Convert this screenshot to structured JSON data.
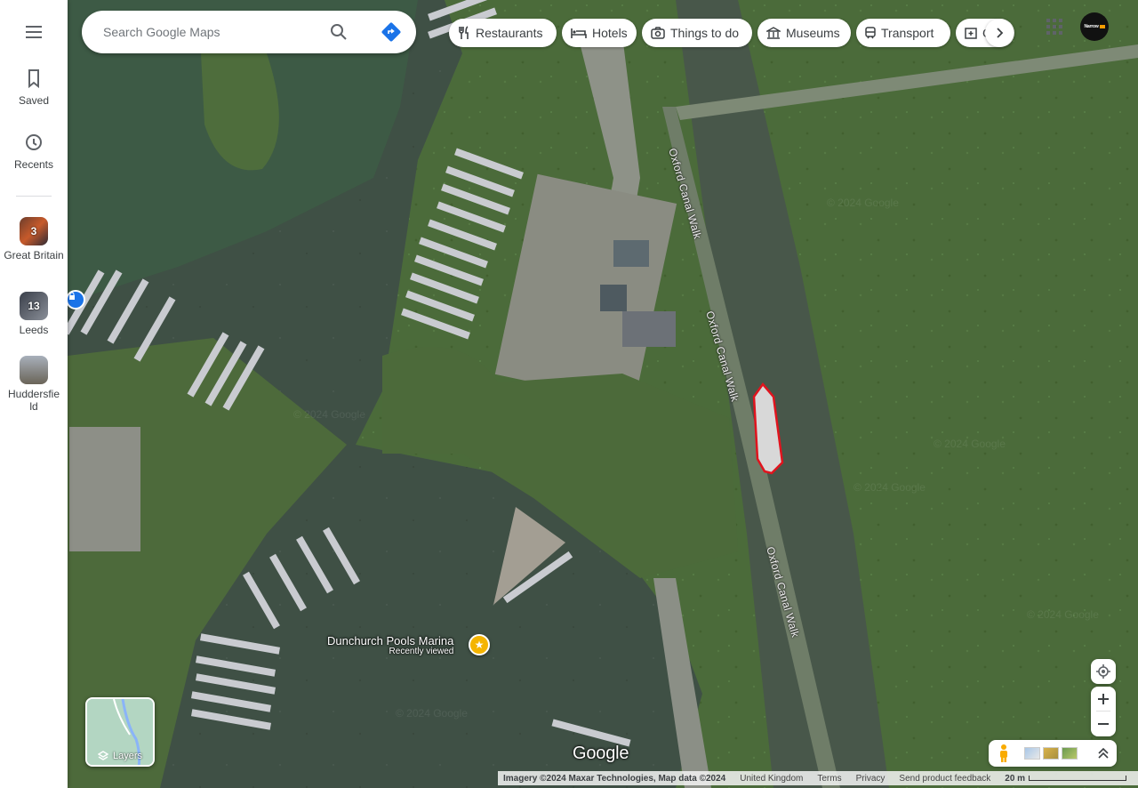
{
  "search": {
    "placeholder": "Search Google Maps"
  },
  "rail": {
    "saved_label": "Saved",
    "recents_label": "Recents",
    "collections": [
      {
        "label": "Great Britain",
        "count": "3"
      },
      {
        "label": "Leeds",
        "count": "13"
      },
      {
        "label": "Huddersfield",
        "count": ""
      }
    ]
  },
  "chips": [
    {
      "label": "Restaurants",
      "icon": "fork-knife-icon"
    },
    {
      "label": "Hotels",
      "icon": "bed-icon"
    },
    {
      "label": "Things to do",
      "icon": "camera-icon"
    },
    {
      "label": "Museums",
      "icon": "museum-icon"
    },
    {
      "label": "Transport",
      "icon": "train-icon"
    },
    {
      "label": "C",
      "icon": "pharmacy-icon"
    }
  ],
  "account": {
    "avatar_text": "Narrow"
  },
  "map": {
    "road_labels": [
      "Oxford Canal Walk",
      "Oxford Canal Walk",
      "Oxford Canal Walk"
    ],
    "place": {
      "name": "Dunchurch Pools Marina",
      "subtitle": "Recently viewed"
    },
    "layers_label": "Layers",
    "logo": "Google"
  },
  "footer": {
    "imagery": "Imagery ©2024 Maxar Technologies, Map data ©2024",
    "region": "United Kingdom",
    "terms": "Terms",
    "privacy": "Privacy",
    "feedback": "Send product feedback",
    "scale": "20 m"
  }
}
